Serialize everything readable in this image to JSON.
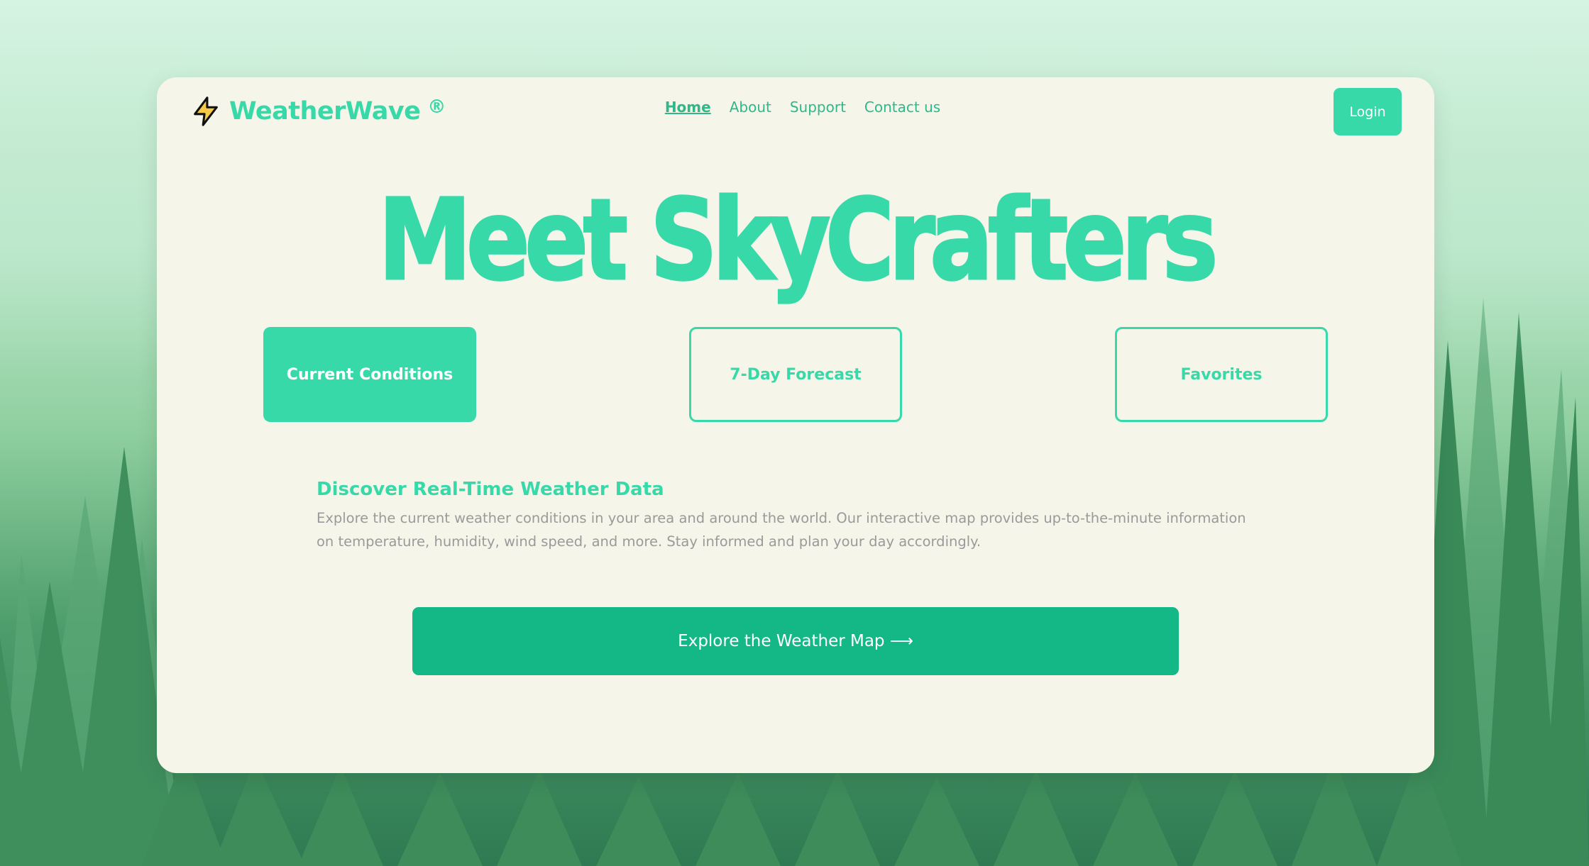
{
  "brand": {
    "name": "WeatherWave",
    "registered_mark": "®",
    "icon": "lightning-bolt-icon"
  },
  "nav": {
    "items": [
      {
        "label": "Home",
        "active": true
      },
      {
        "label": "About",
        "active": false
      },
      {
        "label": "Support",
        "active": false
      },
      {
        "label": "Contact us",
        "active": false
      }
    ]
  },
  "header": {
    "login_label": "Login"
  },
  "hero": {
    "title": "Meet SkyCrafters"
  },
  "tabs": [
    {
      "label": "Current Conditions",
      "selected": true
    },
    {
      "label": "7-Day Forecast",
      "selected": false
    },
    {
      "label": "Favorites",
      "selected": false
    }
  ],
  "section": {
    "title": "Discover Real-Time Weather Data",
    "description": "Explore the current weather conditions in your area and around the world. Our interactive map provides up-to-the-minute information on temperature, humidity, wind speed, and more. Stay informed and plan your day accordingly."
  },
  "cta": {
    "label": "Explore the Weather Map ⟶"
  },
  "colors": {
    "accent": "#38d9a9",
    "cta": "#14b886",
    "card_bg": "#f5f5ea",
    "body_text": "#9a9a9a"
  }
}
